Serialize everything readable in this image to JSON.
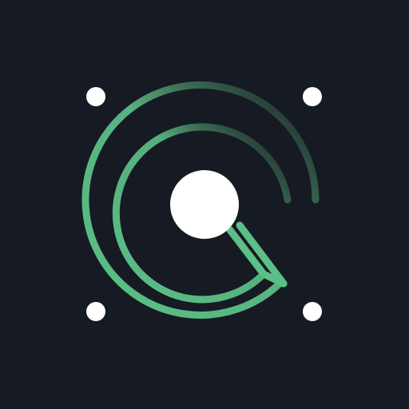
{
  "icon": {
    "name": "radar-scan-logo",
    "background_color": "#161a23",
    "accent_color": "#5bbf86",
    "center_color": "#ffffff",
    "corner_dot_color": "#ffffff"
  }
}
